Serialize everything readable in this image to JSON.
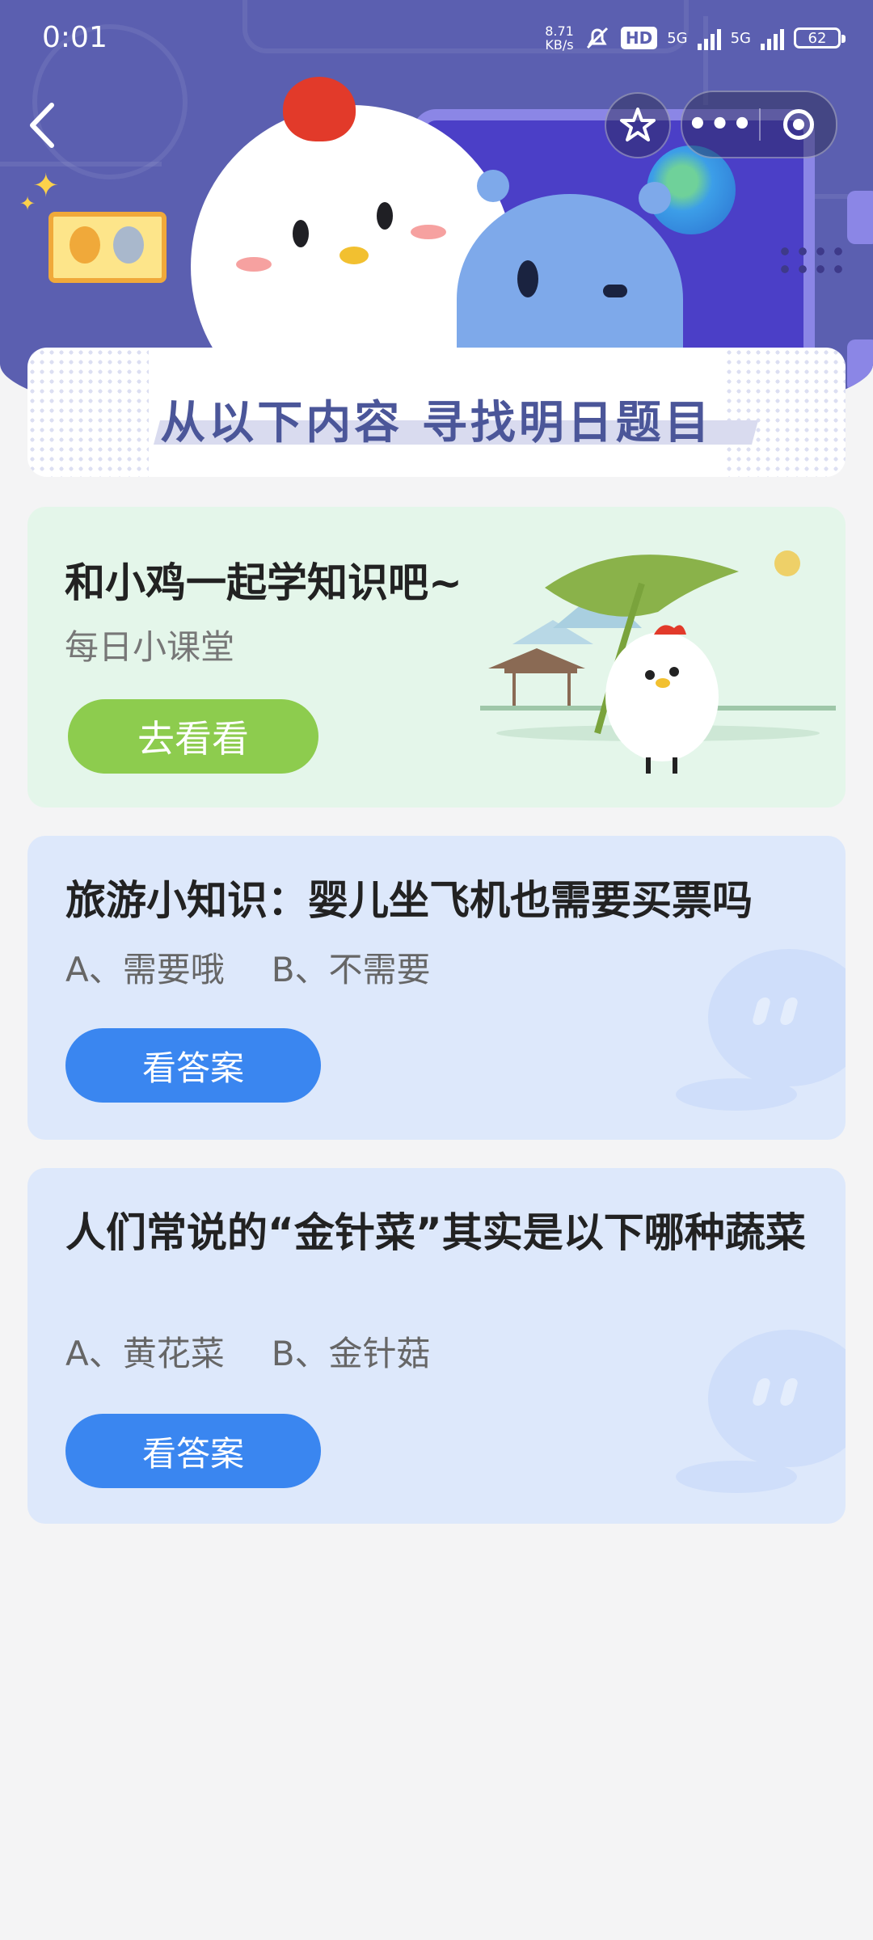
{
  "status_bar": {
    "time": "0:01",
    "net_speed_value": "8.71",
    "net_speed_unit": "KB/s",
    "hd_label": "HD",
    "sim1": "5G",
    "sim2": "5G",
    "battery": "62"
  },
  "header": {
    "banner_title": "从以下内容  寻找明日题目"
  },
  "learn_card": {
    "title": "和小鸡一起学知识吧~",
    "subtitle": "每日小课堂",
    "button": "去看看"
  },
  "questions": [
    {
      "title": "旅游小知识：婴儿坐飞机也需要买票吗",
      "option_a": "A、需要哦",
      "option_b": "B、不需要",
      "button": "看答案"
    },
    {
      "title": "人们常说的“金针菜”其实是以下哪种蔬菜",
      "option_a": "A、黄花菜",
      "option_b": "B、金针菇",
      "button": "看答案"
    }
  ],
  "colors": {
    "header_bg": "#5b5fb0",
    "banner_text": "#4b5699",
    "learn_bg": "#e4f6ea",
    "green_button": "#8dcc4e",
    "question_bg": "#dde8fb",
    "blue_button": "#3a86f0"
  },
  "icons": {
    "back": "chevron-left-icon",
    "favorite": "star-icon",
    "more": "more-dots-icon",
    "close": "target-close-icon"
  }
}
